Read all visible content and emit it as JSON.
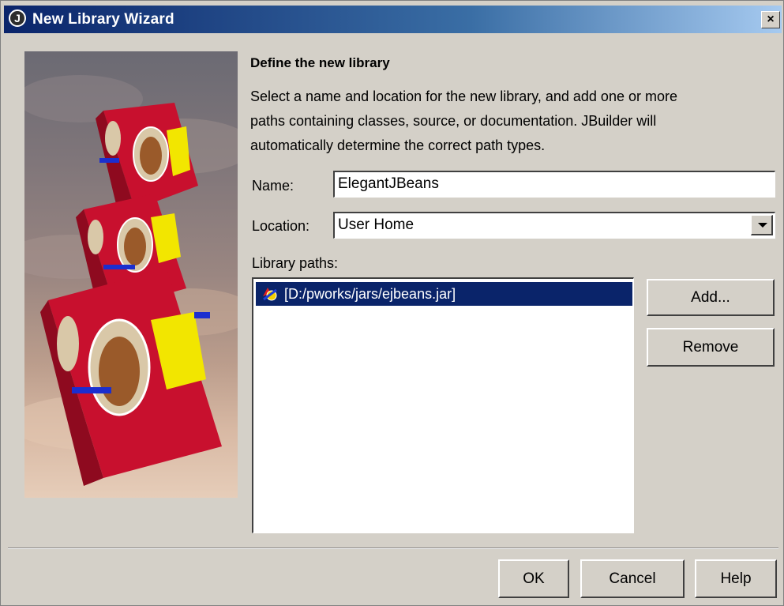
{
  "window": {
    "title": "New Library Wizard",
    "close_glyph": "×"
  },
  "content": {
    "heading": "Define the new library",
    "description": "Select a name and location for the new library, and add one or more\npaths containing classes, source, or documentation. JBuilder will\nautomatically determine the correct path types."
  },
  "form": {
    "name_label": "Name:",
    "name_value": "ElegantJBeans",
    "location_label": "Location:",
    "location_value": "User Home",
    "library_paths_label": "Library paths:"
  },
  "library_paths": {
    "items": [
      {
        "label": "[D:/pworks/jars/ejbeans.jar]",
        "icon": "jar-file-icon",
        "selected": true
      }
    ]
  },
  "buttons": {
    "add": "Add...",
    "remove": "Remove",
    "ok": "OK",
    "cancel": "Cancel",
    "help": "Help"
  },
  "colors": {
    "title_bar_start": "#0a246a",
    "title_bar_end": "#a6caf0",
    "dialog_background": "#d4d0c8",
    "selection_background": "#0a246a"
  }
}
